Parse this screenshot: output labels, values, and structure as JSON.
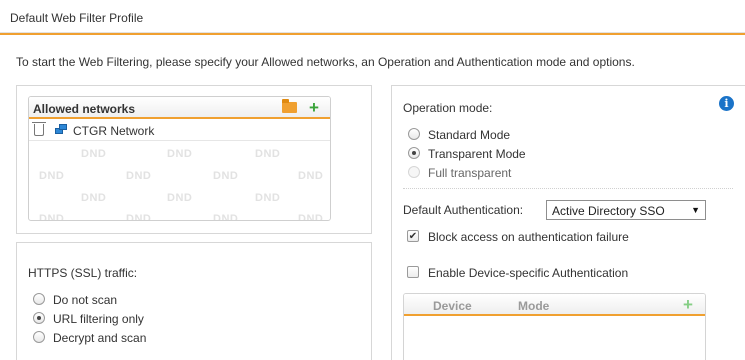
{
  "window": {
    "title": "Default Web Filter Profile"
  },
  "intro_text": "To start the Web Filtering, please specify your Allowed networks, an Operation and Authentication mode and options.",
  "allowed_networks": {
    "header": "Allowed networks",
    "rows": [
      {
        "label": "CTGR Network"
      }
    ],
    "placeholder_text": "DND"
  },
  "https": {
    "label": "HTTPS (SSL) traffic:",
    "options": [
      {
        "label": "Do not scan",
        "selected": false
      },
      {
        "label": "URL filtering only",
        "selected": true
      },
      {
        "label": "Decrypt and scan",
        "selected": false
      }
    ]
  },
  "operation": {
    "label": "Operation mode:",
    "options": [
      {
        "label": "Standard Mode",
        "selected": false,
        "enabled": true
      },
      {
        "label": "Transparent Mode",
        "selected": true,
        "enabled": true
      },
      {
        "label": "Full transparent",
        "selected": false,
        "enabled": false
      }
    ]
  },
  "authentication": {
    "label": "Default Authentication:",
    "selected": "Active Directory SSO",
    "block_on_failure": {
      "label": "Block access on authentication failure",
      "checked": true
    },
    "device_specific": {
      "label": "Enable Device-specific Authentication",
      "checked": false
    }
  },
  "device_table": {
    "columns": [
      "Device",
      "Mode"
    ]
  },
  "colors": {
    "accent": "#f0a030",
    "info": "#1a73c8",
    "add": "#3aa43a"
  }
}
